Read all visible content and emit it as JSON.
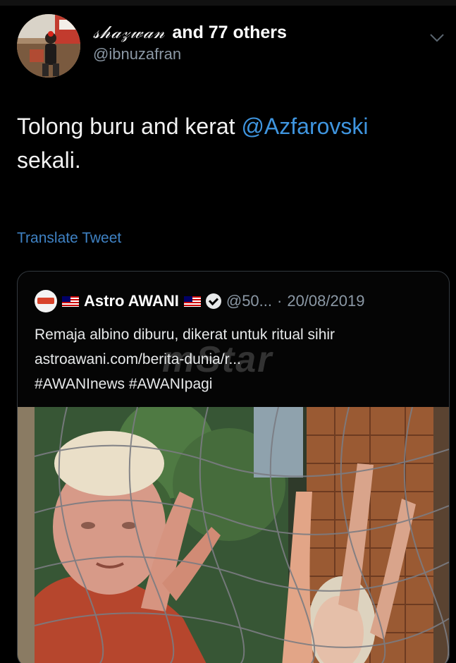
{
  "tweet": {
    "display_name": "𝓈𝒽𝒶𝓏𝓌𝒶𝓃",
    "others_text": "and 77 others",
    "handle": "@ibnuzafran",
    "text_before": "Tolong buru and kerat ",
    "mention": "@Azfarovski",
    "text_after": "sekali.",
    "translate_label": "Translate Tweet"
  },
  "quoted": {
    "name": "Astro AWANI",
    "handle": "@50...",
    "separator": "·",
    "date": "20/08/2019",
    "line1": "Remaja albino diburu, dikerat untuk ritual sihir",
    "line2": "astroawani.com/berita-dunia/r...",
    "line3": "#AWANInews #AWANIpagi",
    "watermark": "mStar"
  },
  "icons": {
    "menu": "chevron-down-icon",
    "verified": "verified-badge-icon",
    "flag": "malaysia-flag-icon",
    "logo": "astro-awani-logo"
  },
  "colors": {
    "background": "#000000",
    "link": "#3f95df",
    "secondary": "#8b98a5",
    "border": "#33393f"
  }
}
